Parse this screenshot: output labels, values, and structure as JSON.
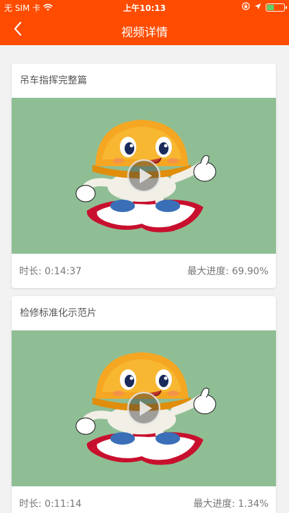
{
  "status_bar": {
    "carrier": "无 SIM 卡",
    "time": "上午10:13",
    "battery_level": 0.45
  },
  "nav": {
    "title": "视频详情"
  },
  "videos": [
    {
      "title": "吊车指挥完整篇",
      "duration_label": "时长:",
      "duration": "0:14:37",
      "progress_label": "最大进度:",
      "progress": "69.90%"
    },
    {
      "title": "检修标准化示范片",
      "duration_label": "时长:",
      "duration": "0:11:14",
      "progress_label": "最大进度:",
      "progress": "1.34%"
    }
  ],
  "colors": {
    "brand": "#ff4c00",
    "thumbnail_bg": "#8fbe95"
  },
  "icons": {
    "back": "chevron-left-icon",
    "play": "play-icon",
    "wifi": "wifi-icon",
    "location": "location-arrow-icon",
    "lock": "orientation-lock-icon"
  }
}
